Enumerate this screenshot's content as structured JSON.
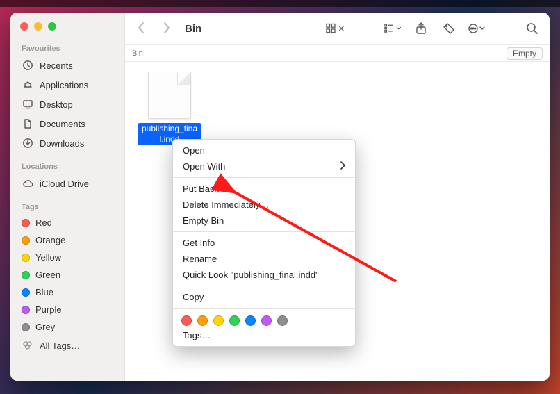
{
  "window": {
    "title": "Bin"
  },
  "pathbar": {
    "current": "Bin",
    "empty_button": "Empty"
  },
  "sidebar": {
    "favourites_label": "Favourites",
    "favourites": [
      {
        "label": "Recents",
        "icon": "clock-icon"
      },
      {
        "label": "Applications",
        "icon": "apps-icon"
      },
      {
        "label": "Desktop",
        "icon": "desktop-icon"
      },
      {
        "label": "Documents",
        "icon": "document-icon"
      },
      {
        "label": "Downloads",
        "icon": "download-icon"
      }
    ],
    "locations_label": "Locations",
    "locations": [
      {
        "label": "iCloud Drive",
        "icon": "cloud-icon"
      }
    ],
    "tags_label": "Tags",
    "tags": [
      {
        "label": "Red",
        "color": "#ff5a52"
      },
      {
        "label": "Orange",
        "color": "#ff9f0a"
      },
      {
        "label": "Yellow",
        "color": "#ffd60a"
      },
      {
        "label": "Green",
        "color": "#30d158"
      },
      {
        "label": "Blue",
        "color": "#0a84ff"
      },
      {
        "label": "Purple",
        "color": "#bf5af2"
      },
      {
        "label": "Grey",
        "color": "#8e8e93"
      }
    ],
    "all_tags_label": "All Tags…"
  },
  "file": {
    "name": "publishing_final.indd"
  },
  "context_menu": {
    "open": "Open",
    "open_with": "Open With",
    "put_back": "Put Back",
    "delete_imm": "Delete Immediately…",
    "empty_bin": "Empty Bin",
    "get_info": "Get Info",
    "rename": "Rename",
    "quick_look": "Quick Look \"publishing_final.indd\"",
    "copy": "Copy",
    "tags": "Tags…",
    "tag_colors": [
      "#ff5a52",
      "#ff9f0a",
      "#ffd60a",
      "#30d158",
      "#0a84ff",
      "#bf5af2",
      "#8e8e93"
    ]
  },
  "annotation": {
    "arrow_to": "put_back"
  }
}
